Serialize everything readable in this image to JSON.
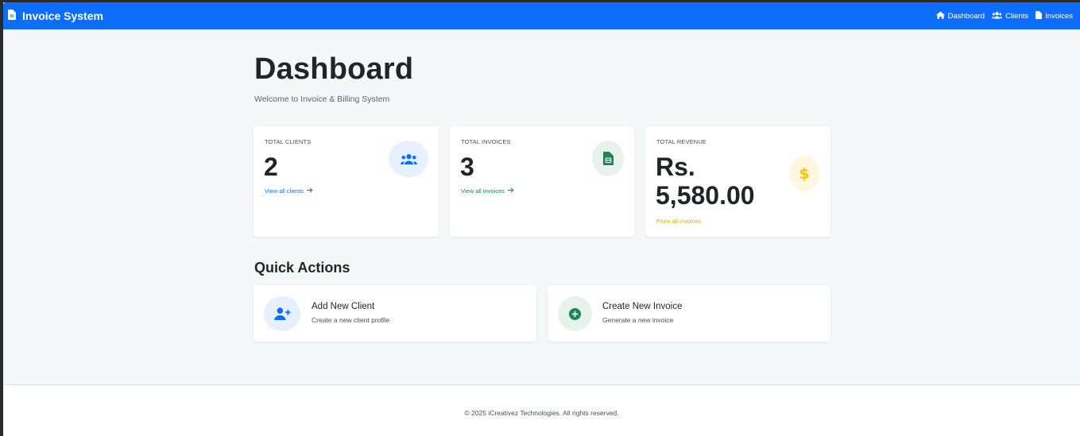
{
  "navbar": {
    "brand": "Invoice System",
    "links": [
      {
        "label": "Dashboard",
        "icon": "home-icon"
      },
      {
        "label": "Clients",
        "icon": "users-icon"
      },
      {
        "label": "Invoices",
        "icon": "file-icon"
      }
    ]
  },
  "page": {
    "title": "Dashboard",
    "subtitle": "Welcome to Invoice & Billing System"
  },
  "stats": {
    "clients": {
      "label": "TOTAL CLIENTS",
      "value": "2",
      "link": "View all clients",
      "icon": "users-icon",
      "color": "#0d6efd",
      "icon_bg": "#e7f0fe"
    },
    "invoices": {
      "label": "TOTAL INVOICES",
      "value": "3",
      "link": "View all invoices",
      "icon": "invoice-icon",
      "color": "#198754",
      "icon_bg": "#e8f2ec"
    },
    "revenue": {
      "label": "TOTAL REVENUE",
      "value_line1": "Rs.",
      "value_line2": "5,580.00",
      "note": "From all invoices",
      "icon": "dollar-icon",
      "color": "#ffc107",
      "icon_bg": "#fff7e0"
    }
  },
  "quick_actions": {
    "title": "Quick Actions",
    "items": [
      {
        "title": "Add New Client",
        "desc": "Create a new client profile",
        "icon": "user-plus-icon"
      },
      {
        "title": "Create New Invoice",
        "desc": "Generate a new invoice",
        "icon": "plus-circle-icon"
      }
    ]
  },
  "footer": {
    "text": "© 2025 iCreativez Technologies. All rights reserved."
  }
}
